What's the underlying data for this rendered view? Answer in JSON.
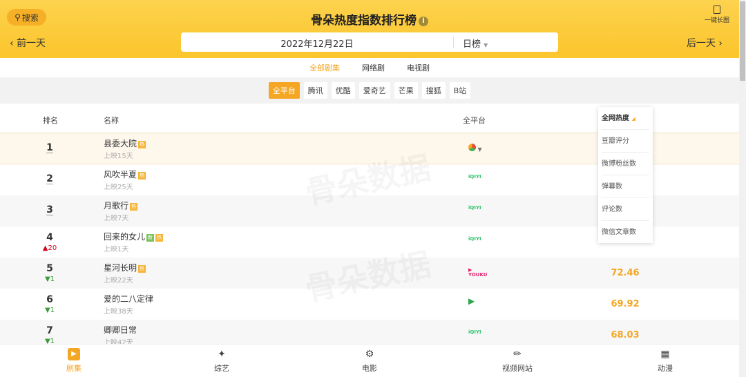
{
  "header": {
    "search": "搜索",
    "title": "骨朵热度指数排行榜",
    "long_image": "一键长图",
    "prev": "前一天",
    "next": "后一天",
    "date": "2022年12月22日",
    "period": "日榜"
  },
  "category_tabs": [
    {
      "label": "全部剧集",
      "active": true
    },
    {
      "label": "网络剧"
    },
    {
      "label": "电视剧"
    }
  ],
  "platforms": [
    {
      "label": "全平台",
      "active": true
    },
    {
      "label": "腾讯"
    },
    {
      "label": "优酷"
    },
    {
      "label": "爱奇艺"
    },
    {
      "label": "芒果"
    },
    {
      "label": "搜狐"
    },
    {
      "label": "B站"
    }
  ],
  "columns": {
    "rank": "排名",
    "name": "名称",
    "platform": "全平台"
  },
  "sort_menu": [
    "全网热度",
    "豆瓣评分",
    "微博粉丝数",
    "弹幕数",
    "评论数",
    "微信文章数"
  ],
  "rows": [
    {
      "rank": "1",
      "change": "",
      "name": "县委大院",
      "tags": [
        "热"
      ],
      "sub": "上映15天",
      "platform": "multi",
      "score": ""
    },
    {
      "rank": "2",
      "change": "",
      "name": "风吹半夏",
      "tags": [
        "热"
      ],
      "sub": "上映25天",
      "platform": "iqiyi",
      "score": ""
    },
    {
      "rank": "3",
      "change": "",
      "name": "月歌行",
      "tags": [
        "热"
      ],
      "sub": "上映7天",
      "platform": "iqiyi",
      "score": ""
    },
    {
      "rank": "4",
      "change": "20",
      "dir": "up",
      "name": "回来的女儿",
      "tags": [
        "新",
        "热"
      ],
      "sub": "上映1天",
      "platform": "iqiyi",
      "score": ""
    },
    {
      "rank": "5",
      "change": "1",
      "dir": "down",
      "name": "星河长明",
      "tags": [
        "热"
      ],
      "sub": "上映22天",
      "platform": "youku",
      "score": "72.46"
    },
    {
      "rank": "6",
      "change": "1",
      "dir": "down",
      "name": "爱的二八定律",
      "tags": [],
      "sub": "上映38天",
      "platform": "tencent",
      "score": "69.92"
    },
    {
      "rank": "7",
      "change": "1",
      "dir": "down",
      "name": "卿卿日常",
      "tags": [],
      "sub": "上映42天",
      "platform": "iqiyi",
      "score": "68.03"
    }
  ],
  "watermark": "骨朵数据",
  "bottom_nav": [
    {
      "label": "剧集",
      "active": true
    },
    {
      "label": "综艺"
    },
    {
      "label": "电影"
    },
    {
      "label": "视频网站"
    },
    {
      "label": "动漫"
    }
  ],
  "colors": {
    "accent": "#f5a623",
    "header": "#fbc52c",
    "up": "#d0021b",
    "down": "#3a9b3a"
  }
}
